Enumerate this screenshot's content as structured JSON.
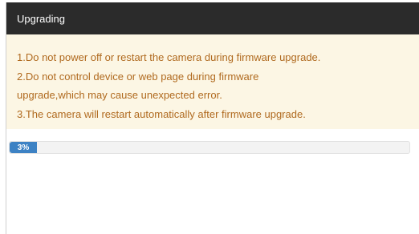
{
  "dialog": {
    "title": "Upgrading",
    "notice_lines": [
      "1.Do not power off or restart the camera during firmware upgrade.",
      "2.Do not control device or web page during firmware",
      "upgrade,which may cause unexpected error.",
      "3.The camera will restart automatically after firmware upgrade."
    ],
    "progress": {
      "label": "3%",
      "value_percent": 3
    }
  },
  "colors": {
    "header_bg": "#2b2b2b",
    "notice_bg": "#fcf6e4",
    "notice_text": "#b06a1f",
    "progress_fill": "#3d82c4"
  }
}
